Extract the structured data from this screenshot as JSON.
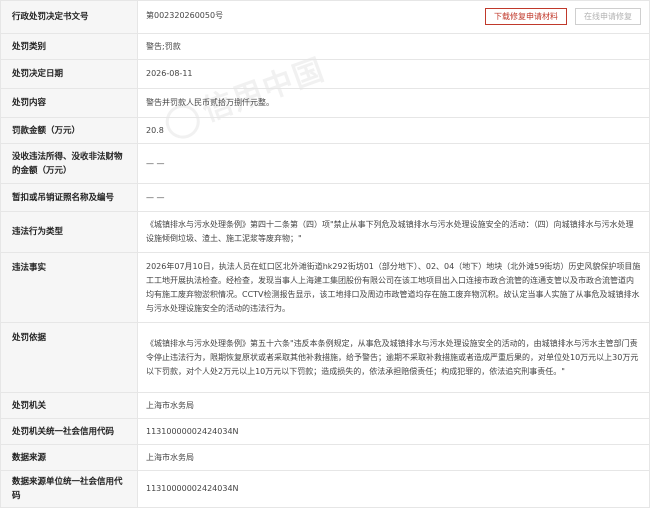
{
  "rows": [
    {
      "label": "行政处罚决定书文号",
      "value": "第002320260050号"
    },
    {
      "label": "处罚类别",
      "value": "警告;罚款"
    },
    {
      "label": "处罚决定日期",
      "value": "2026-08-11"
    },
    {
      "label": "处罚内容",
      "value": "警告并罚款人民币贰拾万捌仟元整。"
    },
    {
      "label": "罚款金额（万元）",
      "value": "20.8"
    },
    {
      "label": "没收违法所得、没收非法财物的金额（万元）",
      "value": "— —"
    },
    {
      "label": "暂扣或吊销证照名称及编号",
      "value": "— —"
    },
    {
      "label": "违法行为类型",
      "value": "《城镇排水与污水处理条例》第四十二条第（四）项\"禁止从事下列危及城镇排水与污水处理设施安全的活动：（四）向城镇排水与污水处理设施倾倒垃圾、渣土、施工泥浆等废弃物；\""
    },
    {
      "label": "违法事实",
      "value": "2026年07月10日，执法人员在虹口区北外滩街道hk292街坊01（部分地下）、02、04（地下）地块（北外滩59街坊）历史风貌保护项目施工工地开展执法检查。经检查，发现当事人上海建工集团股份有限公司在该工地项目出入口连接市政合流管的连通支管以及市政合流管道内均有施工废弃物淤积情况。CCTV检测报告显示，该工地排口及周边市政管道均存在施工废弃物沉积。故认定当事人实施了从事危及城镇排水与污水处理设施安全的活动的违法行为。"
    },
    {
      "label": "处罚依据",
      "value": "《城镇排水与污水处理条例》第五十六条\"违反本条例规定，从事危及城镇排水与污水处理设施安全的活动的，由城镇排水与污水主管部门责令停止违法行为，限期恢复原状或者采取其他补救措施，给予警告；逾期不采取补救措施或者造成严重后果的，对单位处10万元以上30万元以下罚款，对个人处2万元以上10万元以下罚款；造成损失的，依法承担赔偿责任；构成犯罪的，依法追究刑事责任。\""
    },
    {
      "label": "处罚机关",
      "value": "上海市水务局"
    },
    {
      "label": "处罚机关统一社会信用代码",
      "value": "11310000002424034N"
    },
    {
      "label": "数据来源",
      "value": "上海市水务局"
    },
    {
      "label": "数据来源单位统一社会信用代码",
      "value": "11310000002424034N"
    }
  ],
  "buttons": {
    "download": "下载修复申请材料",
    "online": "在线申请修复"
  },
  "watermark": "信用中国",
  "colors": {
    "accent": "#c0392b",
    "label_bg": "#f6f6f6",
    "border": "#e6e6e6"
  }
}
